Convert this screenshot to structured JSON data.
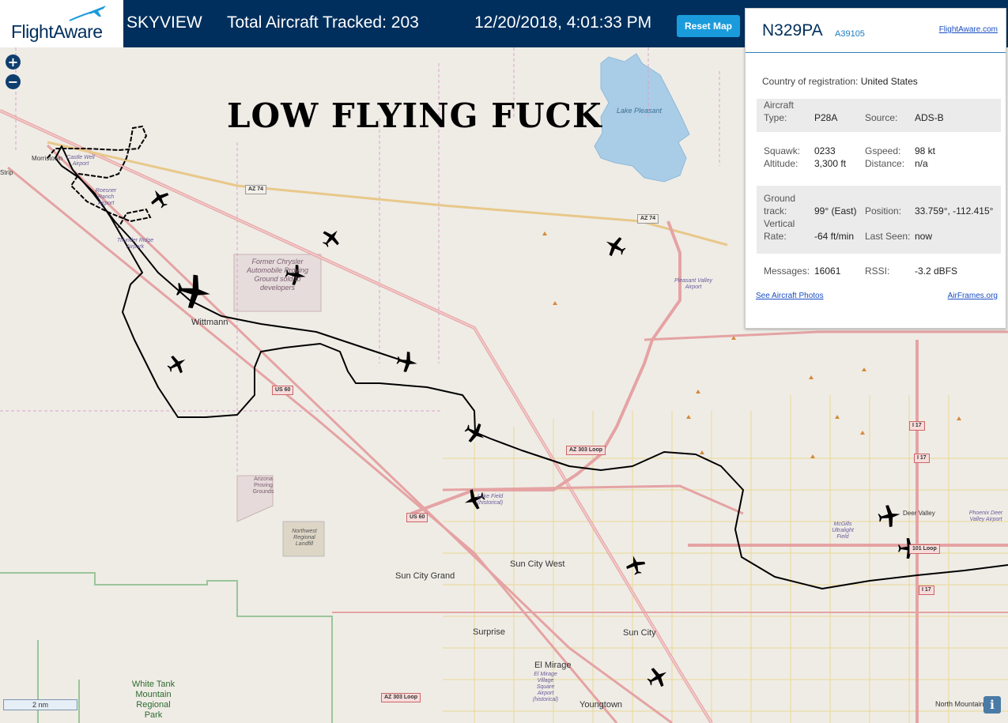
{
  "header": {
    "logo": "FlightAware",
    "app_name": "SKYVIEW",
    "tracked_label": "Total Aircraft Tracked:",
    "tracked_count": "203",
    "datetime": "12/20/2018, 4:01:33 PM",
    "reset_button": "Reset Map"
  },
  "map": {
    "annotation": "LOW FLYING FUCK",
    "zoom_in": "+",
    "zoom_out": "−",
    "scale": "2 nm",
    "info": "i",
    "places": {
      "morristown": "Morristown",
      "wittmann": "Wittmann",
      "lake_pleasant": "Lake Pleasant",
      "sun_city_grand": "Sun City Grand",
      "sun_city_west": "Sun City West",
      "sun_city": "Sun City",
      "surprise": "Surprise",
      "el_mirage": "El Mirage",
      "youngtown": "Youngtown",
      "deer_valley": "Deer Valley",
      "north_mountain": "North Mountain",
      "white_tank": "White Tank Mountain Regional Park",
      "chrysler": "Former Chrysler Automobile Proving Ground sold to developers",
      "arizona_proving": "Arizona Proving Grounds",
      "landfill": "Northwest Regional Landfill",
      "strip": "Strip"
    },
    "airports": {
      "castle_well": "Castle Well Airport",
      "roesner": "Roesner Ranch Airport",
      "thunder_ridge": "Thunder Ridge Airpark",
      "pleasant_valley": "Pleasant Valley Airport",
      "glendale": "Luke Field (historical)",
      "mcgills": "McGills Ultralight Field",
      "phoenix_dv": "Phoenix Deer Valley Airport",
      "el_mirage_village": "El Mirage Village Square Airport (historical)"
    },
    "roads": {
      "az74_a": "AZ 74",
      "az74_b": "AZ 74",
      "us60_a": "US 60",
      "us60_b": "US 60",
      "az303_a": "AZ 303 Loop",
      "az303_b": "AZ 303 Loop",
      "i17_a": "I 17",
      "i17_b": "I 17",
      "i17_c": "I 17",
      "loop101": "101 Loop"
    }
  },
  "panel": {
    "registration": "N329PA",
    "hex_code": "A39105",
    "flightaware_link": "FlightAware.com",
    "country_label": "Country of registration:",
    "country_value": "United States",
    "aircraft_type_label_1": "Aircraft",
    "aircraft_type_label_2": "Type:",
    "aircraft_type": "P28A",
    "source_label": "Source:",
    "source": "ADS-B",
    "squawk_label": "Squawk:",
    "squawk": "0233",
    "gspeed_label": "Gspeed:",
    "gspeed": "98 kt",
    "altitude_label": "Altitude:",
    "altitude": "3,300 ft",
    "distance_label": "Distance:",
    "distance": "n/a",
    "ground_track_label_1": "Ground",
    "ground_track_label_2": "track:",
    "ground_track": "99° (East)",
    "position_label": "Position:",
    "position": "33.759°, -112.415°",
    "vrate_label_1": "Vertical",
    "vrate_label_2": "Rate:",
    "vertical_rate": "-64 ft/min",
    "last_seen_label": "Last Seen:",
    "last_seen": "now",
    "messages_label": "Messages:",
    "messages": "16061",
    "rssi_label": "RSSI:",
    "rssi": "-3.2 dBFS",
    "photos_link": "See Aircraft Photos",
    "airframes_link": "AirFrames.org"
  },
  "colors": {
    "header_bg": "#002f5d",
    "accent": "#1a9bdc",
    "map_bg": "#efece6",
    "track": "#000000",
    "highway": "#e8a860",
    "arterial": "#e5a3a3",
    "water": "#a9cde7"
  }
}
